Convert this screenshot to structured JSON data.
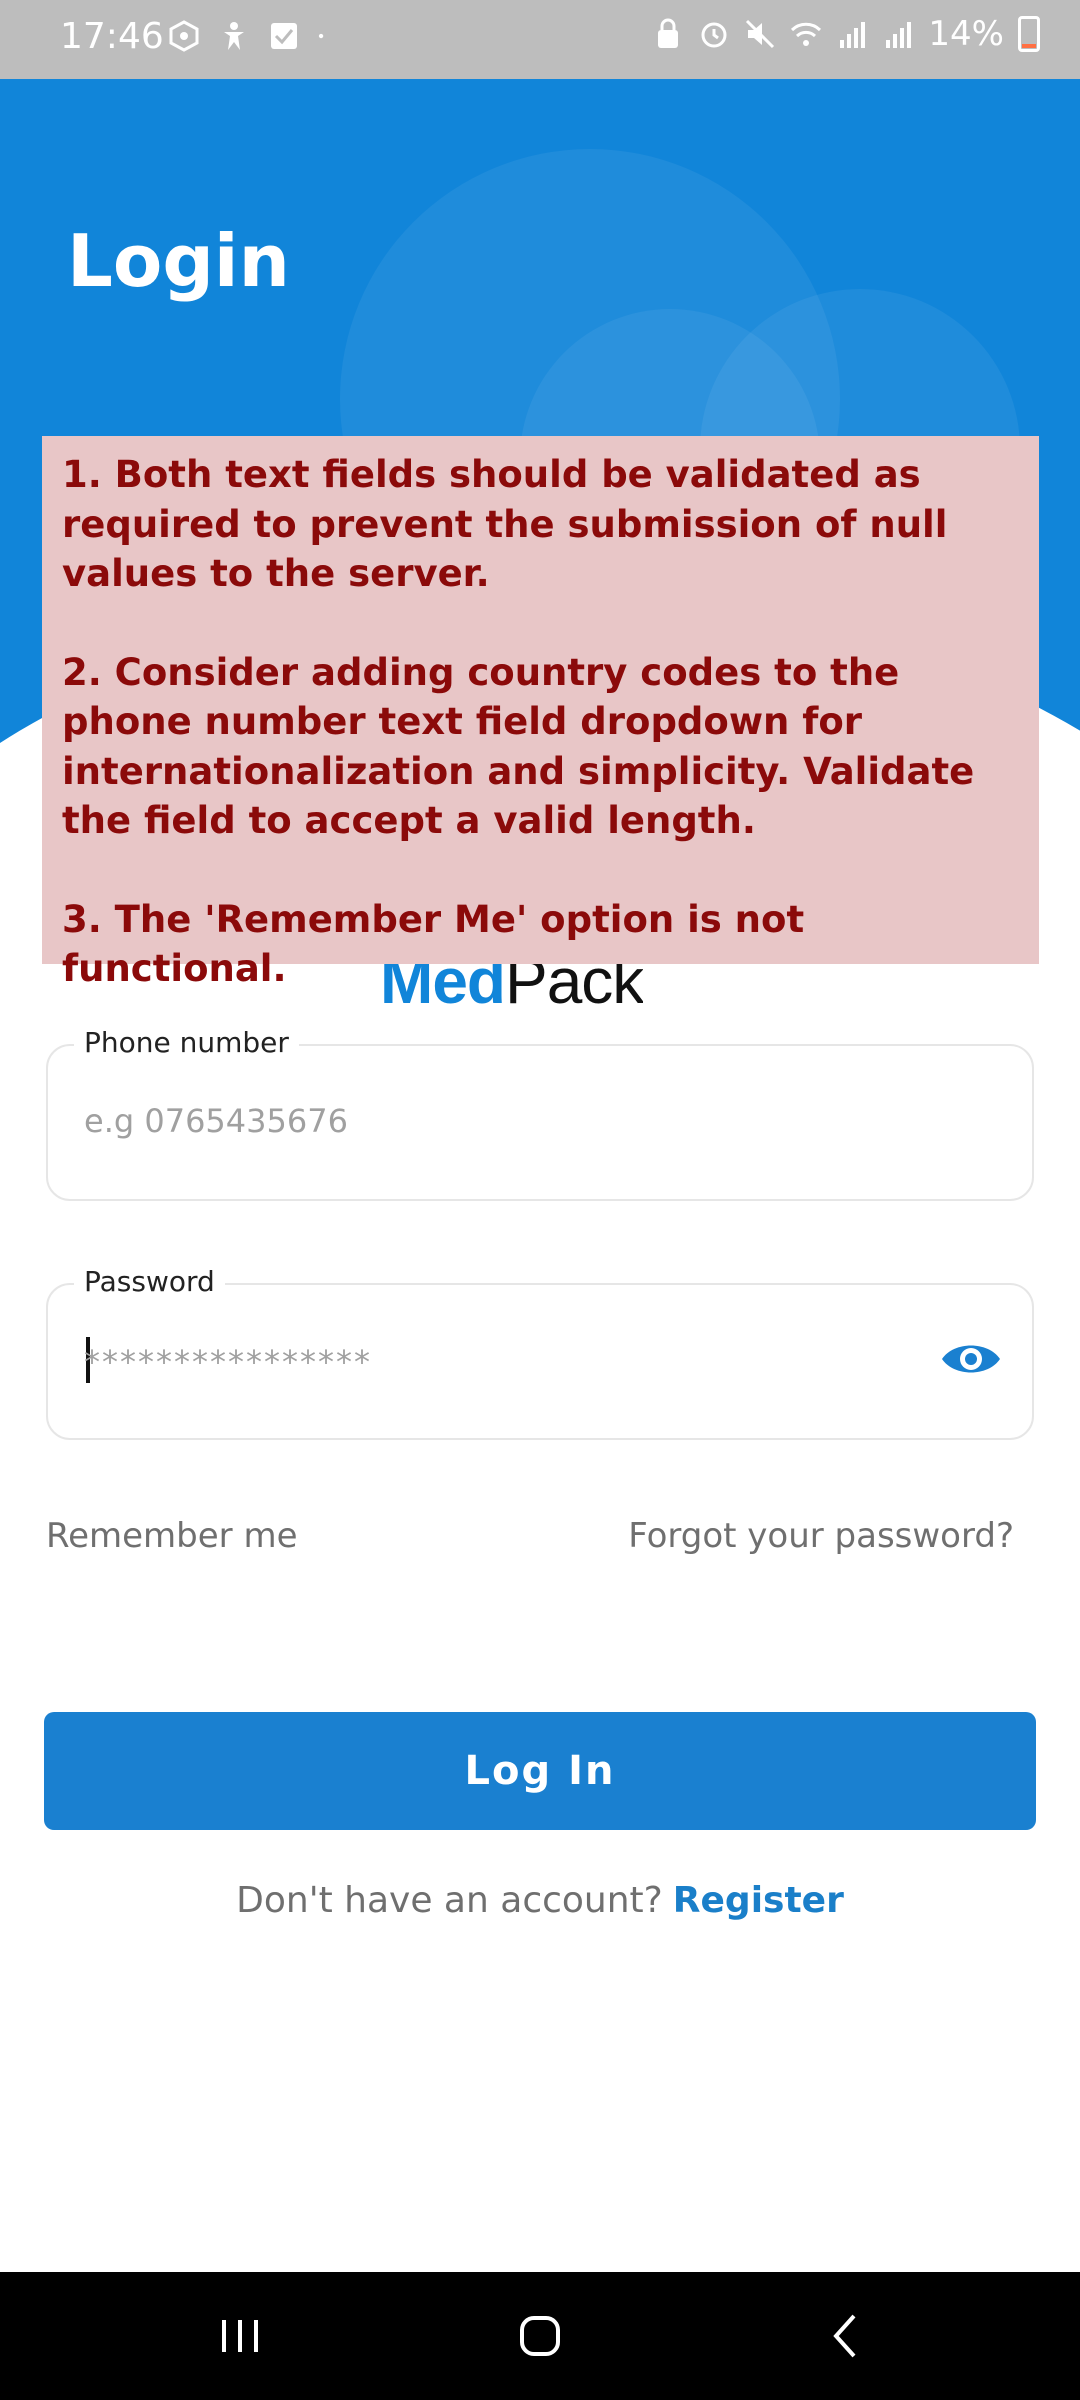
{
  "status_bar": {
    "time": "17:46",
    "battery": "14%",
    "battery_level": 0.14,
    "left_icons": [
      "vpn-icon",
      "accessibility-icon",
      "checkbox-icon",
      "dot-icon"
    ],
    "right_icons": [
      "lock-icon",
      "alarm-icon",
      "mute-icon",
      "wifi-icon",
      "signal-icon",
      "signal-icon"
    ]
  },
  "header": {
    "title": "Login",
    "bg_color": "#1185d9"
  },
  "review_note": {
    "items": [
      "1. Both text fields should be validated as required to prevent the submission of null values to the server.",
      "2. Consider adding country codes to the phone number text field dropdown for internationalization and simplicity. Validate the field to accept a valid length.",
      "3. The 'Remember Me'  option is not functional."
    ],
    "bg_color": "#e8c6c7",
    "text_color": "#8b0a0a"
  },
  "logo": {
    "part1": "Med",
    "part2": "Pack"
  },
  "form": {
    "phone": {
      "label": "Phone number",
      "placeholder": "e.g 0765435676"
    },
    "password": {
      "label": "Password",
      "placeholder": "****************",
      "toggle_icon": "eye-icon"
    },
    "remember_me": "Remember me",
    "forgot_password": "Forgot your password?",
    "login_button": "Log In",
    "register_prompt": "Don't have an account?",
    "register_link": "Register",
    "accent_color": "#1a80d0"
  },
  "nav_bar": {
    "buttons": [
      "recent-apps-icon",
      "home-icon",
      "back-icon"
    ]
  }
}
